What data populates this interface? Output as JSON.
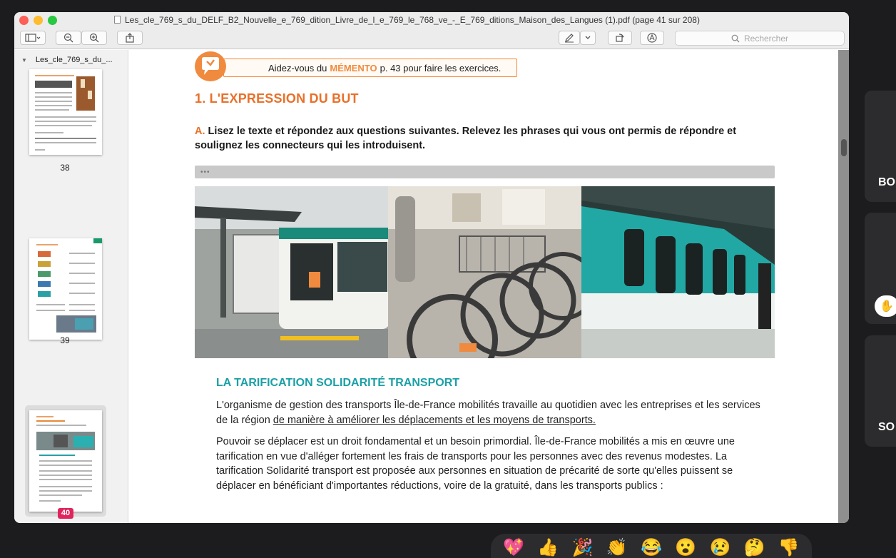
{
  "window": {
    "title": "Les_cle_769_s_du_DELF_B2_Nouvelle_e_769_dition_Livre_de_l_e_769_le_768_ve_-_E_769_ditions_Maison_des_Langues (1).pdf (page 41 sur 208)",
    "search_placeholder": "Rechercher"
  },
  "sidebar": {
    "header_label": "Les_cle_769_s_du_...",
    "pages": [
      {
        "number": "38"
      },
      {
        "number": "39"
      },
      {
        "number": "40",
        "selected": true
      }
    ]
  },
  "document": {
    "memento_prefix": "Aidez-vous du",
    "memento_highlight": "MÉMENTO",
    "memento_suffix": "p. 43 pour faire les exercices.",
    "heading": "1. L'EXPRESSION DU BUT",
    "question_letter": "A.",
    "question_text": "Lisez le texte et répondez aux questions suivantes. Relevez les phrases qui vous ont permis de répondre et soulignez les connecteurs qui les introduisent.",
    "photo_bar_dots": "•••",
    "section_title": "LA TARIFICATION SOLIDARITÉ TRANSPORT",
    "para1_start": "L'organisme de gestion des transports Île-de-France mobilités travaille au quotidien avec les entreprises et les services de la région",
    "para1_underlined": "de manière à améliorer les déplacements et les moyens de transports.",
    "para2": "Pouvoir se déplacer est un droit fondamental et un besoin primordial. Île-de-France mobilités a mis en œuvre une tarification en vue d'alléger fortement les frais de transports pour les personnes avec des revenus modestes. La tarification Solidarité transport est proposée aux personnes en situation de précarité de sorte qu'elles puissent se déplacer en bénéficiant d'importantes réductions, voire de la gratuité, dans les transports publics :"
  },
  "participants": {
    "tile1_label": "BO",
    "tile3_label": "SO"
  },
  "reactions": [
    "💖",
    "👍",
    "🎉",
    "👏",
    "😂",
    "😮",
    "😢",
    "🤔",
    "👎"
  ],
  "colors": {
    "accent_orange": "#f08a3e",
    "teal": "#1aa0a6",
    "selected_badge": "#e0245e"
  }
}
